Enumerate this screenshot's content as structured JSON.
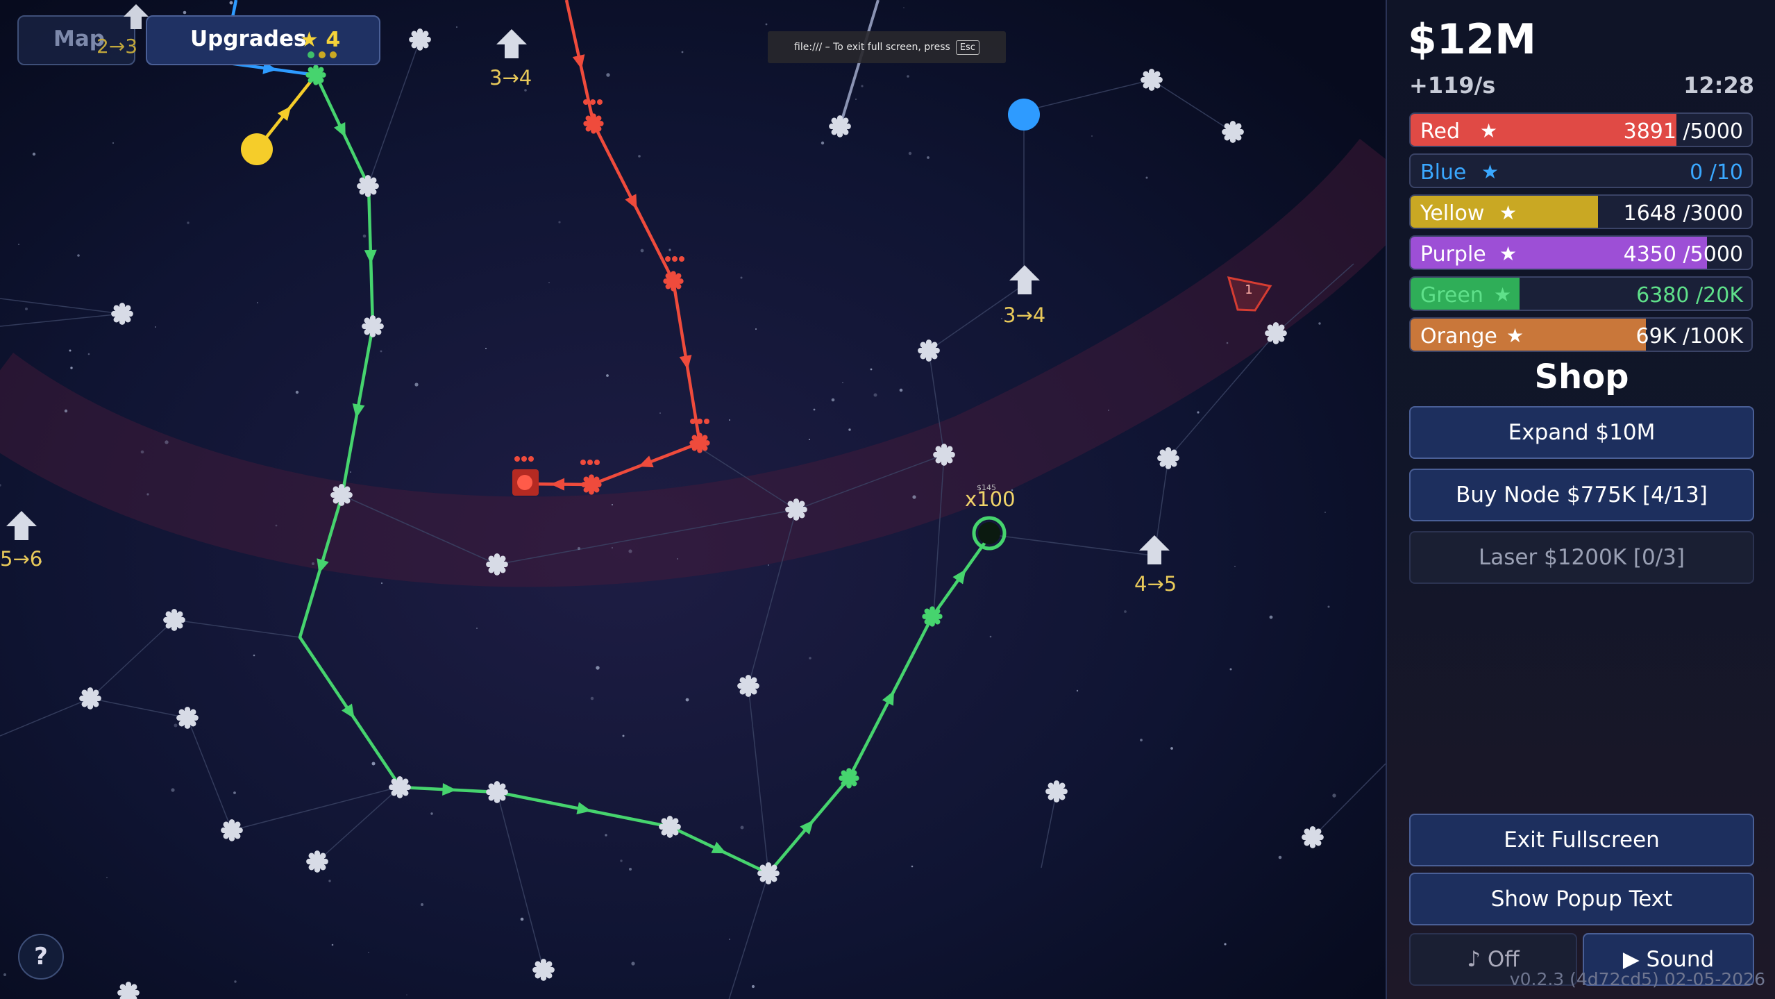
{
  "top_bar": {
    "map_label": "Map",
    "map_level": "2→3",
    "upgrades_label": "Upgrades",
    "upgrades_count": "4"
  },
  "fullscreen_notice": {
    "text": "file:/// – To exit full screen, press",
    "key": "Esc"
  },
  "map": {
    "level_labels": [
      "3→4",
      "3→4",
      "5→6",
      "4→5"
    ],
    "multiplier": "x100",
    "price_tag": "$145",
    "enemy_count": "1"
  },
  "help_label": "?",
  "sidebar": {
    "money": "$12M",
    "rate": "+119/s",
    "clock": "12:28",
    "resources": [
      {
        "name": "Red",
        "value": "3891",
        "max": "/5000",
        "fraction": 0.78,
        "color": "#e04a45",
        "text_color": "#ffffff"
      },
      {
        "name": "Blue",
        "value": "0",
        "max": "/10",
        "fraction": 0.0,
        "color": "#2e9bff",
        "text_color": "#3aa8ff"
      },
      {
        "name": "Yellow",
        "value": "1648",
        "max": "/3000",
        "fraction": 0.55,
        "color": "#c9a823",
        "text_color": "#ffffff"
      },
      {
        "name": "Purple",
        "value": "4350",
        "max": "/5000",
        "fraction": 0.87,
        "color": "#9d4fd6",
        "text_color": "#ffffff"
      },
      {
        "name": "Green",
        "value": "6380",
        "max": "/20K",
        "fraction": 0.32,
        "color": "#2fae58",
        "text_color": "#5fe08a"
      },
      {
        "name": "Orange",
        "value": "69K",
        "max": "/100K",
        "fraction": 0.69,
        "color": "#c9773a",
        "text_color": "#ffffff"
      }
    ],
    "shop_title": "Shop",
    "shop_buttons": [
      {
        "label": "Expand  $10M",
        "enabled": true
      },
      {
        "label": "Buy Node  $775K  [4/13]",
        "enabled": true
      },
      {
        "label": "Laser  $1200K  [0/3]",
        "enabled": false
      }
    ],
    "exit_fullscreen": "Exit Fullscreen",
    "show_popup_text": "Show Popup Text",
    "music_toggle": "♪ Off",
    "sound_toggle": "▶ Sound",
    "version": "v0.2.3 (4d72cd5) 02-05-2026"
  }
}
